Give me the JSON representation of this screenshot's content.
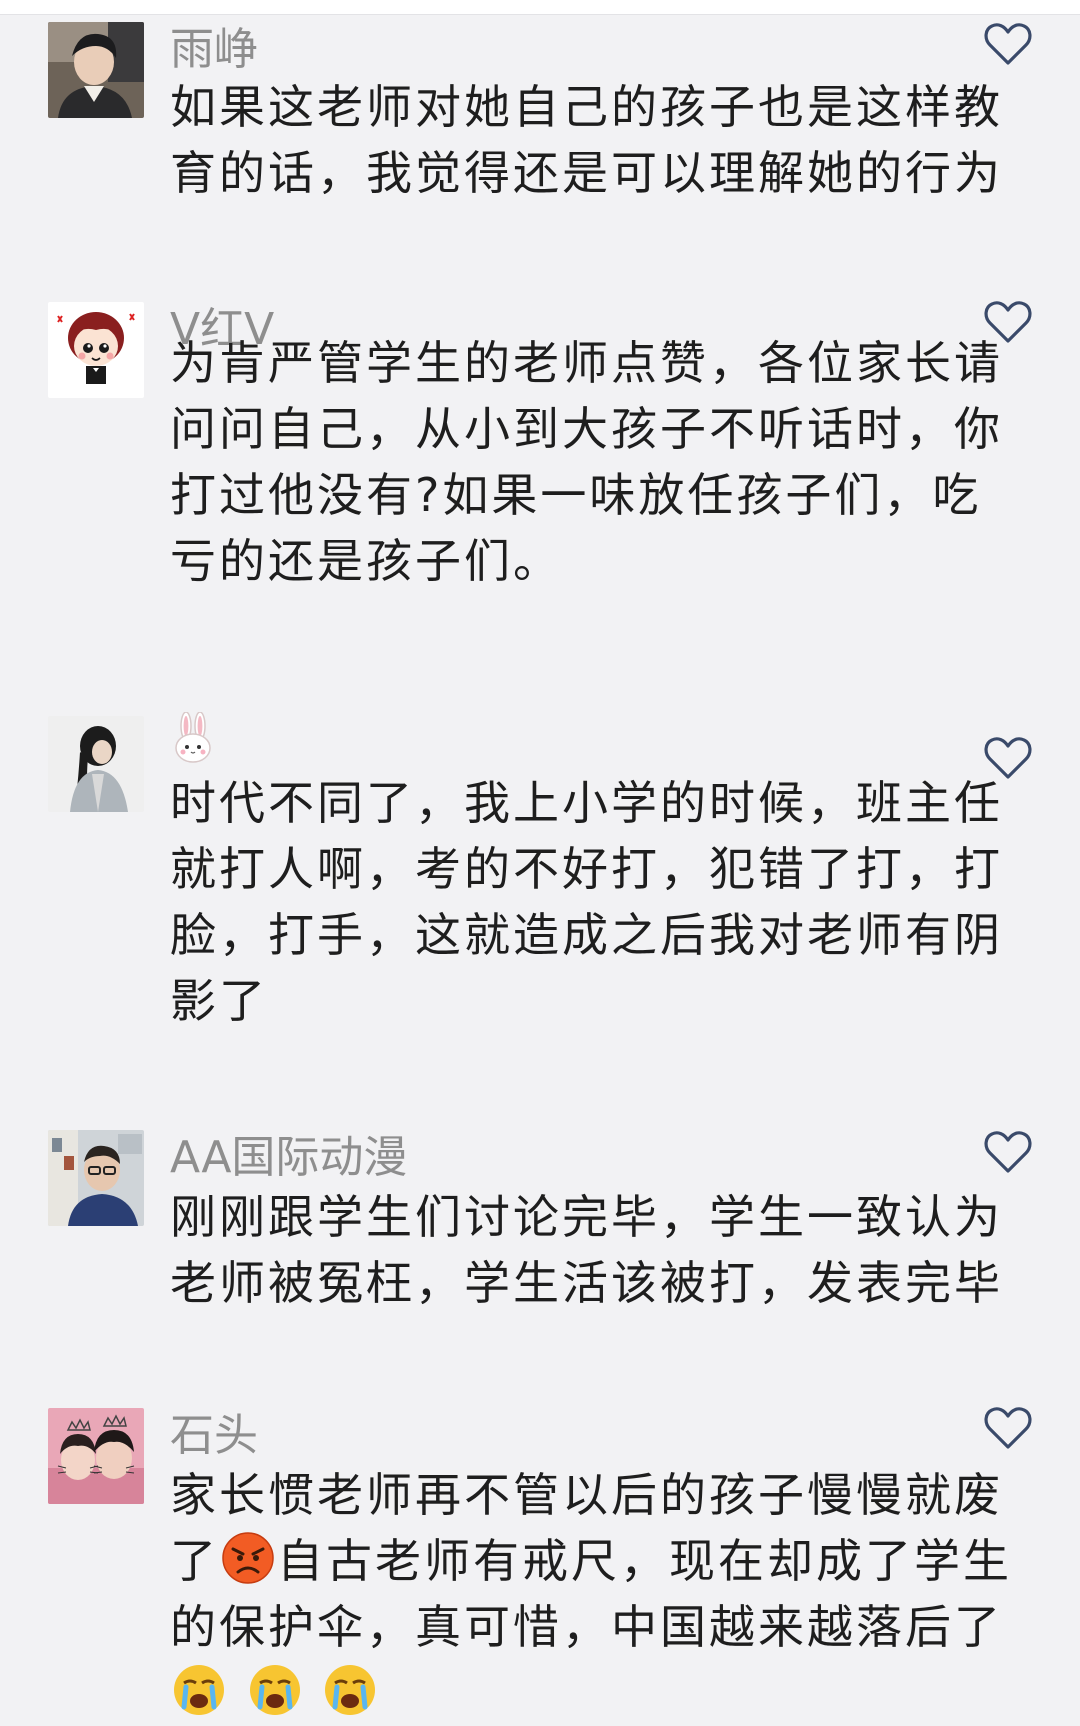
{
  "colors": {
    "background": "#f2f2f4",
    "username": "#8e8e8e",
    "text": "#1e1e1e",
    "heart_outline": "#3a4a6a"
  },
  "comments": [
    {
      "username": "雨峥",
      "avatar": "photo-young-man",
      "lines": [
        "如果这老师对她自己的孩子也是这样教",
        "育的话，我觉得还是可以理解她的行为"
      ],
      "liked": false,
      "like_icon": "heart-outline-icon"
    },
    {
      "username": "V红V",
      "avatar": "cartoon-boy",
      "lines": [
        "为肯严管学生的老师点赞，各位家长请",
        "问问自己，从小到大孩子不听话时，你",
        "打过他没有?如果一味放任孩子们，吃",
        "亏的还是孩子们。"
      ],
      "liked": false,
      "like_icon": "heart-outline-icon"
    },
    {
      "username": "",
      "username_icon": "rabbit-emoji-icon",
      "avatar": "photo-girl",
      "lines": [
        "时代不同了，我上小学的时候，班主任",
        "就打人啊，考的不好打，犯错了打，打",
        "脸，打手，这就造成之后我对老师有阴",
        "影了"
      ],
      "liked": false,
      "like_icon": "heart-outline-icon"
    },
    {
      "username": "AA国际动漫",
      "avatar": "photo-man-glasses",
      "lines": [
        "刚刚跟学生们讨论完毕，学生一致认为",
        "老师被冤枉，学生活该被打，发表完毕"
      ],
      "liked": false,
      "like_icon": "heart-outline-icon"
    },
    {
      "username": "石头",
      "avatar": "photo-couple-crowns",
      "line1": "家长惯老师再不管以后的孩子慢慢就废",
      "line2_pre": "了",
      "line2_post": "自古老师有戒尺，现在却成了学生",
      "line3": "的保护伞，真可惜，中国越来越落后了",
      "angry_icon": "angry-face-emoji-icon",
      "crying_icon": "crying-face-emoji-icon",
      "liked": false,
      "like_icon": "heart-outline-icon"
    }
  ]
}
